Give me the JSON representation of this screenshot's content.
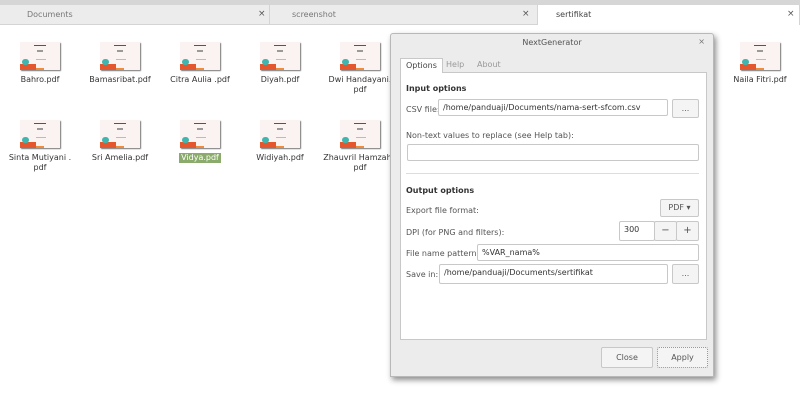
{
  "tabs": [
    {
      "label": "Documents",
      "close": "×"
    },
    {
      "label": "screenshot",
      "close": "×"
    },
    {
      "label": "sertifikat",
      "close": "×"
    }
  ],
  "files": [
    {
      "name": "Bahro.pdf"
    },
    {
      "name": "Bamasribat.pdf"
    },
    {
      "name": "Citra Aulia  .pdf"
    },
    {
      "name": "Diyah.pdf"
    },
    {
      "name": "Dwi Handayani.",
      "name2": "pdf"
    },
    {
      "name": "Naila Fitri.pdf"
    },
    {
      "name": "Sinta Mutiyani  .",
      "name2": "pdf"
    },
    {
      "name": "Sri Amelia.pdf"
    },
    {
      "name": "Vidya.pdf",
      "selected": true
    },
    {
      "name": "Widiyah.pdf"
    },
    {
      "name": "Zhauvril Hamzah  .",
      "name2": "pdf"
    }
  ],
  "dialog": {
    "title": "NextGenerator",
    "close": "×",
    "tabs": [
      "Options",
      "Help",
      "About"
    ],
    "input_heading": "Input options",
    "csv_label": "CSV file:",
    "csv_value": "/home/panduaji/Documents/nama-sert-sfcom.csv",
    "browse": "...",
    "nontext_label": "Non-text values to replace (see Help tab):",
    "nontext_value": "",
    "output_heading": "Output options",
    "format_label": "Export file format:",
    "format_value": "PDF ▾",
    "dpi_label": "DPI (for PNG and filters):",
    "dpi_value": "300",
    "minus": "−",
    "plus": "+",
    "pattern_label": "File name pattern:",
    "pattern_value": "%VAR_nama%",
    "save_label": "Save in:",
    "save_value": "/home/panduaji/Documents/sertifikat",
    "close_btn": "Close",
    "apply_btn": "Apply"
  }
}
